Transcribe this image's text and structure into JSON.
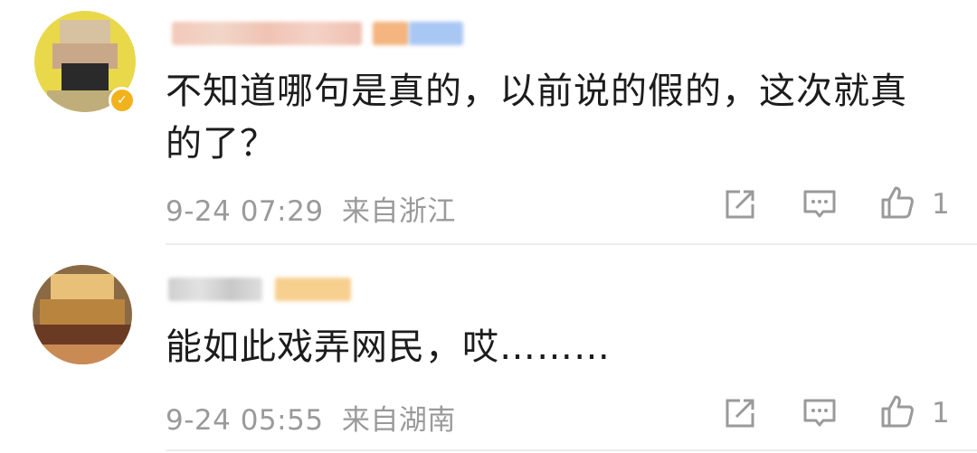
{
  "comments": [
    {
      "text_line1": "不知道哪句是真的，以前说的假的，这次就真",
      "text_line2": "的了？",
      "time": "9-24 07:29",
      "location": "来自浙江",
      "likes": "1"
    },
    {
      "text_line1": "能如此戏弄网民，哎………",
      "time": "9-24 05:55",
      "location": "来自湖南",
      "likes": "1"
    }
  ],
  "icons": {
    "share": "share-icon",
    "reply": "comment-icon",
    "like": "thumbs-up-icon"
  },
  "colors": {
    "meta_text": "#9a9a9a",
    "body_text": "#1c1c1c",
    "icon": "#9a9a9a",
    "divider": "#ececec",
    "vip_badge": "#f2b21c",
    "level_badge": "#8ab4f2"
  }
}
